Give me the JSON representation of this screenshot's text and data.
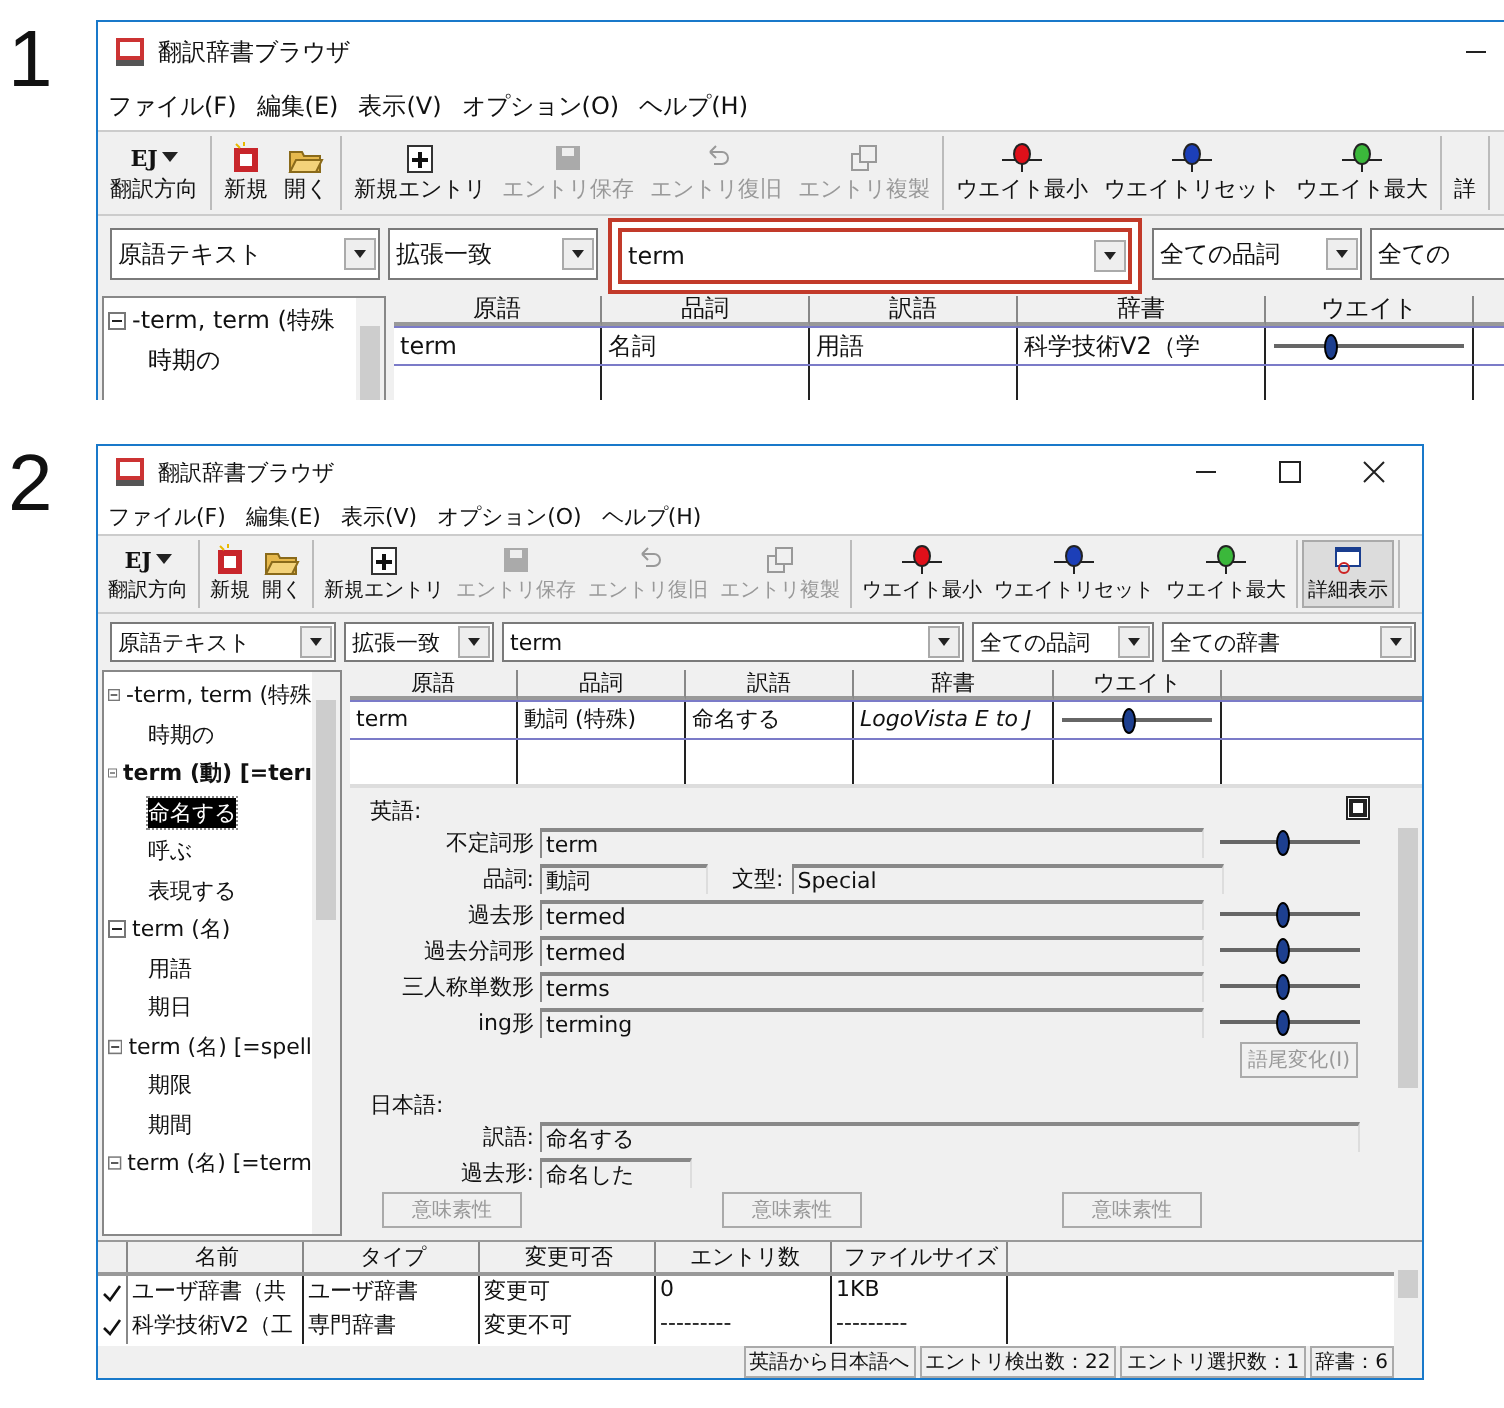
{
  "steps": [
    {
      "number": "1",
      "window": {
        "title": "翻訳辞書ブラウザ",
        "menu": [
          "ファイル(F)",
          "編集(E)",
          "表示(V)",
          "オプション(O)",
          "ヘルプ(H)"
        ],
        "toolbar_groups": [
          [
            {
              "code": "EJ",
              "label": "翻訳方向",
              "disabled": false,
              "selected": false
            }
          ],
          [
            {
              "label": "新規",
              "disabled": false,
              "selected": false
            },
            {
              "label": "開く",
              "disabled": false,
              "selected": false
            }
          ],
          [
            {
              "label": "新規エントリ",
              "disabled": false,
              "selected": false
            },
            {
              "label": "エントリ保存",
              "disabled": true,
              "selected": false
            },
            {
              "label": "エントリ復旧",
              "disabled": true,
              "selected": false
            },
            {
              "label": "エントリ複製",
              "disabled": true,
              "selected": false
            }
          ],
          [
            {
              "label": "ウエイト最小",
              "disabled": false,
              "selected": false
            },
            {
              "label": "ウエイトリセット",
              "disabled": false,
              "selected": false
            },
            {
              "label": "ウエイト最大",
              "disabled": false,
              "selected": false
            }
          ],
          [
            {
              "label": "詳",
              "disabled": false,
              "selected": false
            }
          ]
        ],
        "filters": [
          {
            "value": "原語テキスト",
            "highlighted": false
          },
          {
            "value": "拡張一致",
            "highlighted": false
          },
          {
            "value": "term",
            "highlighted": true
          },
          {
            "value": "全ての品詞",
            "highlighted": false
          },
          {
            "value": "全ての",
            "highlighted": false
          }
        ],
        "tree": [
          {
            "label": "-term, term (特殊",
            "expanded": true,
            "current": false,
            "selected": false,
            "children": [
              {
                "label": "時期の",
                "current": false,
                "selected": false
              }
            ]
          }
        ],
        "results": {
          "columns": [
            "原語",
            "品詞",
            "訳語",
            "辞書",
            "ウエイト"
          ],
          "rows": [
            {
              "cells": [
                "term",
                "名詞",
                "用語",
                "科学技術V2（学"
              ],
              "level": 0.3
            }
          ]
        }
      }
    },
    {
      "number": "2",
      "window": {
        "title": "翻訳辞書ブラウザ",
        "menu": [
          "ファイル(F)",
          "編集(E)",
          "表示(V)",
          "オプション(O)",
          "ヘルプ(H)"
        ],
        "toolbar_groups": [
          [
            {
              "code": "EJ",
              "label": "翻訳方向",
              "disabled": false,
              "selected": false
            }
          ],
          [
            {
              "label": "新規",
              "disabled": false,
              "selected": false
            },
            {
              "label": "開く",
              "disabled": false,
              "selected": false
            }
          ],
          [
            {
              "label": "新規エントリ",
              "disabled": false,
              "selected": false
            },
            {
              "label": "エントリ保存",
              "disabled": true,
              "selected": false
            },
            {
              "label": "エントリ復旧",
              "disabled": true,
              "selected": false
            },
            {
              "label": "エントリ複製",
              "disabled": true,
              "selected": false
            }
          ],
          [
            {
              "label": "ウエイト最小",
              "disabled": false,
              "selected": false
            },
            {
              "label": "ウエイトリセット",
              "disabled": false,
              "selected": false
            },
            {
              "label": "ウエイト最大",
              "disabled": false,
              "selected": false
            }
          ],
          [
            {
              "label": "詳細表示",
              "disabled": false,
              "selected": true
            }
          ]
        ],
        "filters": [
          {
            "value": "原語テキスト",
            "highlighted": false
          },
          {
            "value": "拡張一致",
            "highlighted": false
          },
          {
            "value": "term",
            "highlighted": false
          },
          {
            "value": "全ての品詞",
            "highlighted": false
          },
          {
            "value": "全ての辞書",
            "highlighted": false
          }
        ],
        "tree": [
          {
            "label": "-term, term (特殊",
            "expanded": true,
            "current": false,
            "selected": false,
            "children": [
              {
                "label": "時期の",
                "current": false,
                "selected": false
              }
            ]
          },
          {
            "label": "term (動) [=terı",
            "expanded": true,
            "current": true,
            "selected": false,
            "children": [
              {
                "label": "命名する",
                "current": false,
                "selected": true
              },
              {
                "label": "呼ぶ",
                "current": false,
                "selected": false
              },
              {
                "label": "表現する",
                "current": false,
                "selected": false
              }
            ]
          },
          {
            "label": "term (名)",
            "expanded": true,
            "current": false,
            "selected": false,
            "children": [
              {
                "label": "用語",
                "current": false,
                "selected": false
              },
              {
                "label": "期日",
                "current": false,
                "selected": false
              }
            ]
          },
          {
            "label": "term (名) [=spell",
            "expanded": true,
            "current": false,
            "selected": false,
            "children": [
              {
                "label": "期限",
                "current": false,
                "selected": false
              },
              {
                "label": "期間",
                "current": false,
                "selected": false
              }
            ]
          },
          {
            "label": "term (名) [=term",
            "expanded": true,
            "current": false,
            "selected": false
          }
        ],
        "results": {
          "columns": [
            "原語",
            "品詞",
            "訳語",
            "辞書",
            "ウエイト"
          ],
          "rows": [
            {
              "cells": [
                "term",
                "動詞 (特殊)",
                "命名する",
                "LogoVista E to J"
              ],
              "level": 0.45
            }
          ]
        },
        "detail": {
          "sections": [
            {
              "heading": "英語:",
              "rows": [
                {
                  "kind": "field",
                  "label": "不定詞形",
                  "value": "term",
                  "level": 0.45
                },
                {
                  "kind": "pair",
                  "label": "品詞:",
                  "value": "動詞",
                  "label2": "文型:",
                  "value2": "Special"
                },
                {
                  "kind": "field",
                  "label": "過去形",
                  "value": "termed",
                  "level": 0.45
                },
                {
                  "kind": "field",
                  "label": "過去分詞形",
                  "value": "termed",
                  "level": 0.45
                },
                {
                  "kind": "field",
                  "label": "三人称単数形",
                  "value": "terms",
                  "level": 0.45
                },
                {
                  "kind": "field",
                  "label": "ing形",
                  "value": "terming",
                  "level": 0.45
                }
              ],
              "button": {
                "label": "語尾変化(I)",
                "disabled": true
              }
            },
            {
              "heading": "日本語:",
              "rows": [
                {
                  "kind": "wide",
                  "label": "訳語:",
                  "value": "命名する"
                },
                {
                  "kind": "short",
                  "label": "過去形:",
                  "value": "命名した"
                }
              ]
            }
          ],
          "footer_buttons": [
            {
              "label": "意味素性",
              "disabled": true
            },
            {
              "label": "意味素性",
              "disabled": true
            },
            {
              "label": "意味素性",
              "disabled": true
            }
          ]
        },
        "dictionaries": {
          "columns": [
            "名前",
            "タイプ",
            "変更可否",
            "エントリ数",
            "ファイルサイズ"
          ],
          "rows": [
            {
              "checked": true,
              "cells": [
                "ユーザ辞書（共",
                "ユーザ辞書",
                "変更可",
                "0",
                "1KB"
              ]
            },
            {
              "checked": true,
              "cells": [
                "科学技術V2（工",
                "専門辞書",
                "変更不可",
                "---------",
                "---------"
              ]
            }
          ]
        },
        "status_bar": [
          "英語から日本語へ",
          "エントリ検出数：22",
          "エントリ選択数：1",
          "辞書：6"
        ]
      }
    }
  ]
}
